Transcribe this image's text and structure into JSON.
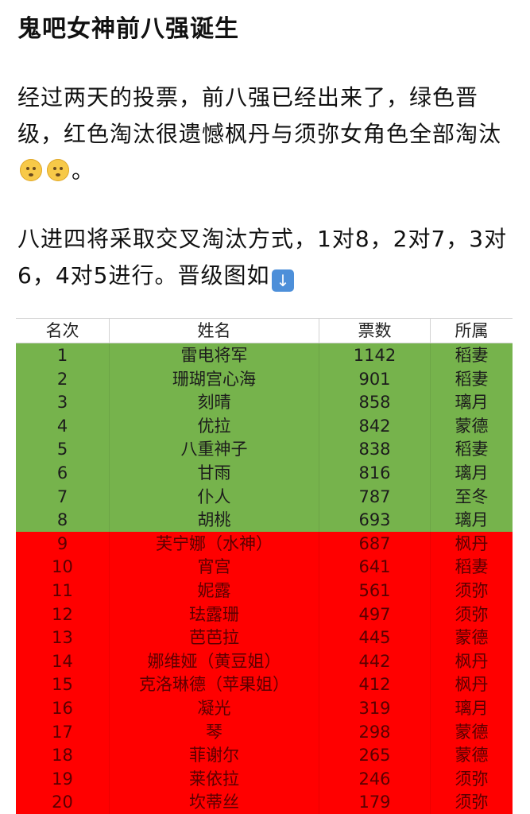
{
  "post": {
    "title": "鬼吧女神前八强诞生",
    "paragraph1_text": "经过两天的投票，前八强已经出来了，绿色晋级，红色淘汰很遗憾枫丹与须弥女角色全部淘汰",
    "paragraph1_end": "。",
    "paragraph2_text": " 八进四将采取交叉淘汰方式，1对8，2对7，3对6，4对5进行。晋级图如",
    "emoji": [
      "sad-face-icon",
      "sad-face-icon",
      "down-arrow-icon"
    ]
  },
  "table": {
    "headers": [
      "名次",
      "姓名",
      "票数",
      "所属"
    ],
    "advance_color": "#76b34c",
    "eliminate_color": "#ff0000",
    "rows": [
      {
        "rank": "1",
        "name": "雷电将军",
        "votes": "1142",
        "region": "稻妻",
        "status": "advance"
      },
      {
        "rank": "2",
        "name": "珊瑚宫心海",
        "votes": "901",
        "region": "稻妻",
        "status": "advance"
      },
      {
        "rank": "3",
        "name": "刻晴",
        "votes": "858",
        "region": "璃月",
        "status": "advance"
      },
      {
        "rank": "4",
        "name": "优拉",
        "votes": "842",
        "region": "蒙德",
        "status": "advance"
      },
      {
        "rank": "5",
        "name": "八重神子",
        "votes": "838",
        "region": "稻妻",
        "status": "advance"
      },
      {
        "rank": "6",
        "name": "甘雨",
        "votes": "816",
        "region": "璃月",
        "status": "advance"
      },
      {
        "rank": "7",
        "name": "仆人",
        "votes": "787",
        "region": "至冬",
        "status": "advance"
      },
      {
        "rank": "8",
        "name": "胡桃",
        "votes": "693",
        "region": "璃月",
        "status": "advance"
      },
      {
        "rank": "9",
        "name": "芙宁娜（水神）",
        "votes": "687",
        "region": "枫丹",
        "status": "eliminate"
      },
      {
        "rank": "10",
        "name": "宵宫",
        "votes": "641",
        "region": "稻妻",
        "status": "eliminate"
      },
      {
        "rank": "11",
        "name": "妮露",
        "votes": "561",
        "region": "须弥",
        "status": "eliminate"
      },
      {
        "rank": "12",
        "name": "珐露珊",
        "votes": "497",
        "region": "须弥",
        "status": "eliminate"
      },
      {
        "rank": "13",
        "name": "芭芭拉",
        "votes": "445",
        "region": "蒙德",
        "status": "eliminate"
      },
      {
        "rank": "14",
        "name": "娜维娅（黄豆姐）",
        "votes": "442",
        "region": "枫丹",
        "status": "eliminate"
      },
      {
        "rank": "15",
        "name": "克洛琳德（苹果姐）",
        "votes": "412",
        "region": "枫丹",
        "status": "eliminate"
      },
      {
        "rank": "16",
        "name": "凝光",
        "votes": "319",
        "region": "璃月",
        "status": "eliminate"
      },
      {
        "rank": "17",
        "name": "琴",
        "votes": "298",
        "region": "蒙德",
        "status": "eliminate"
      },
      {
        "rank": "18",
        "name": "菲谢尔",
        "votes": "265",
        "region": "蒙德",
        "status": "eliminate"
      },
      {
        "rank": "19",
        "name": "莱依拉",
        "votes": "246",
        "region": "须弥",
        "status": "eliminate"
      },
      {
        "rank": "20",
        "name": "坎蒂丝",
        "votes": "179",
        "region": "须弥",
        "status": "eliminate"
      }
    ]
  }
}
